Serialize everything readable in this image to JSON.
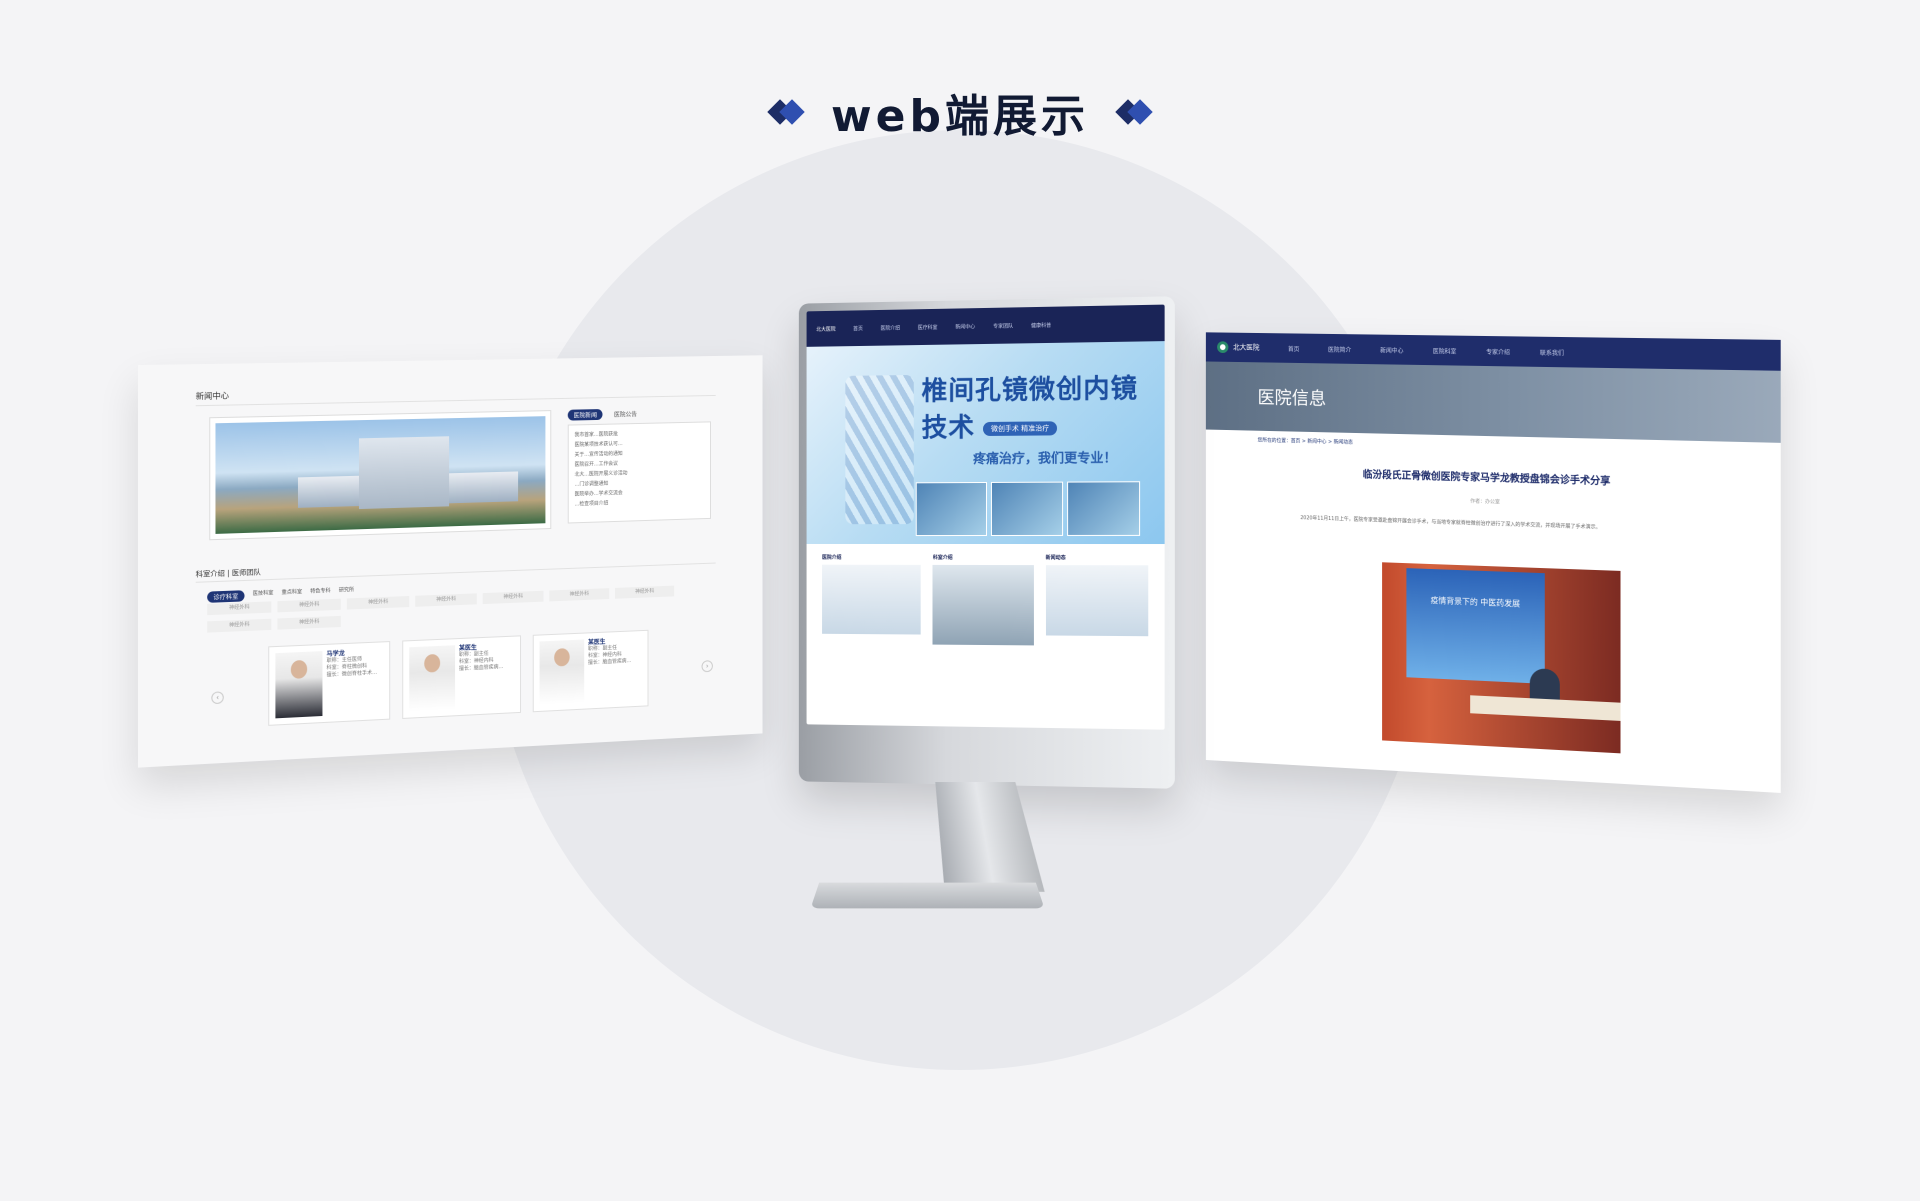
{
  "title": "web端展示",
  "left_site": {
    "news_title": "新闻中心",
    "news_tabs": [
      "医院新闻",
      "医院公告"
    ],
    "news_items": [
      "我市首家…医院获批",
      "医院某项技术获认可…",
      "关于…宣传活动的通知",
      "医院召开…工作会议",
      "北大…医院开展义诊活动",
      "…门诊调整通知",
      "医院举办…学术交流会",
      "…检查项目介绍"
    ],
    "dept_title": "科室介绍 | 医师团队",
    "dept_tabs": [
      "诊疗科室",
      "医技科室",
      "重点科室",
      "特色专科",
      "研究所"
    ],
    "dept_cells": [
      "神经外科",
      "神经外科",
      "神经外科",
      "神经外科",
      "神经外科",
      "神经外科",
      "神经外科",
      "神经外科",
      "神经外科"
    ],
    "doctors": [
      {
        "name": "马学龙",
        "lines": [
          "职称：主任医师",
          "科室：脊柱微创科",
          "擅长：微创脊柱手术…"
        ]
      },
      {
        "name": "某医生",
        "lines": [
          "职称：副主任",
          "科室：神经内科",
          "擅长：脑血管疾病…"
        ]
      },
      {
        "name": "某医生",
        "lines": [
          "职称：副主任",
          "科室：神经内科",
          "擅长：脑血管疾病…"
        ]
      }
    ]
  },
  "center_site": {
    "nav": [
      "首页",
      "医院介绍",
      "医疗科室",
      "新闻中心",
      "专家团队",
      "健康科普"
    ],
    "logo": "北大医院",
    "headline": "椎间孔镜微创内镜技术",
    "pill": "微创手术 精准治疗",
    "sub": "疼痛治疗，我们更专业！",
    "cols": [
      "医院介绍",
      "科室介绍",
      "新闻动态"
    ]
  },
  "right_site": {
    "logo": "北大医院",
    "nav": [
      "首页",
      "医院简介",
      "新闻中心",
      "医院科室",
      "专家介绍",
      "联系我们"
    ],
    "banner": "医院信息",
    "crumb": "您所在的位置：首页 > 新闻中心 > 新闻动态",
    "headline": "临汾段氏正骨微创医院专家马学龙教授盘锦会诊手术分享",
    "meta": "作者：办公室",
    "paragraph": "2020年11月11日上午，医院专家受邀赴盘锦开展会诊手术，与当地专家就脊柱微创治疗进行了深入的学术交流，并现场开展了手术演示。",
    "screen_text": "疫情背景下的\n中医药发展"
  },
  "colors": {
    "navy": "#1f2d6b",
    "accent": "#2f4fb0",
    "title": "#111a33"
  }
}
